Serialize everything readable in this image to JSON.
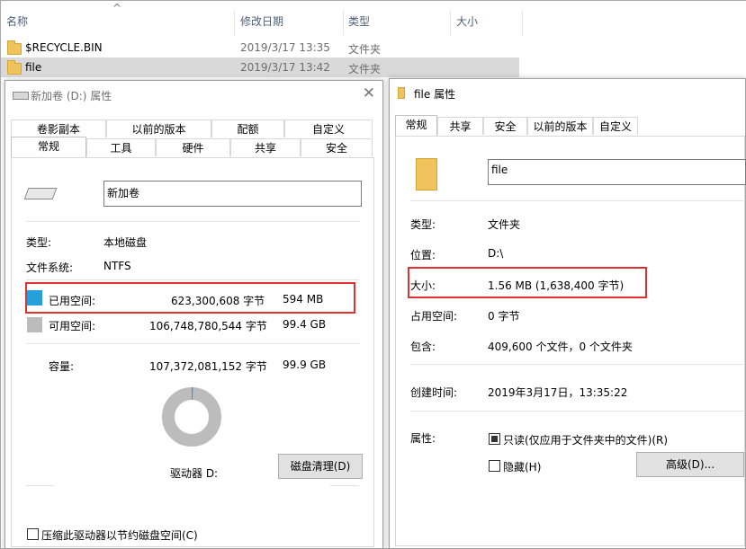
{
  "explorer": {
    "columns": {
      "name": "名称",
      "date": "修改日期",
      "type": "类型",
      "size": "大小"
    },
    "rows": [
      {
        "name": "$RECYCLE.BIN",
        "date": "2019/3/17 13:35",
        "type": "文件夹"
      },
      {
        "name": "file",
        "date": "2019/3/17 13:42",
        "type": "文件夹"
      }
    ]
  },
  "drive_dialog": {
    "title": "新加卷 (D:) 属性",
    "tabs_back": [
      "卷影副本",
      "以前的版本",
      "配额",
      "自定义"
    ],
    "tabs_front": [
      "常规",
      "工具",
      "硬件",
      "共享",
      "安全"
    ],
    "volume_name": "新加卷",
    "type_label": "类型:",
    "type_value": "本地磁盘",
    "fs_label": "文件系统:",
    "fs_value": "NTFS",
    "used_label": "已用空间:",
    "used_bytes": "623,300,608 字节",
    "used_size": "594 MB",
    "free_label": "可用空间:",
    "free_bytes": "106,748,780,544 字节",
    "free_size": "99.4 GB",
    "capacity_label": "容量:",
    "capacity_bytes": "107,372,081,152 字节",
    "capacity_size": "99.9 GB",
    "drive_label": "驱动器 D:",
    "cleanup_button": "磁盘清理(D)",
    "compress_label": "压缩此驱动器以节约磁盘空间(C)",
    "used_fraction": 0.0058,
    "colors": {
      "used": "#26a0da",
      "free": "#bcbcbc",
      "highlight": "#e03030"
    }
  },
  "file_dialog": {
    "title": "file 属性",
    "tabs": [
      "常规",
      "共享",
      "安全",
      "以前的版本",
      "自定义"
    ],
    "name_value": "file",
    "type_label": "类型:",
    "type_value": "文件夹",
    "location_label": "位置:",
    "location_value": "D:\\",
    "size_label": "大小:",
    "size_value": "1.56 MB (1,638,400 字节)",
    "disk_size_label": "占用空间:",
    "disk_size_value": "0 字节",
    "contains_label": "包含:",
    "contains_value": "409,600 个文件，0 个文件夹",
    "created_label": "创建时间:",
    "created_value": "2019年3月17日，13:35:22",
    "attributes_label": "属性:",
    "readonly_label": "只读(仅应用于文件夹中的文件)(R)",
    "hidden_label": "隐藏(H)",
    "advanced_button": "高级(D)..."
  }
}
